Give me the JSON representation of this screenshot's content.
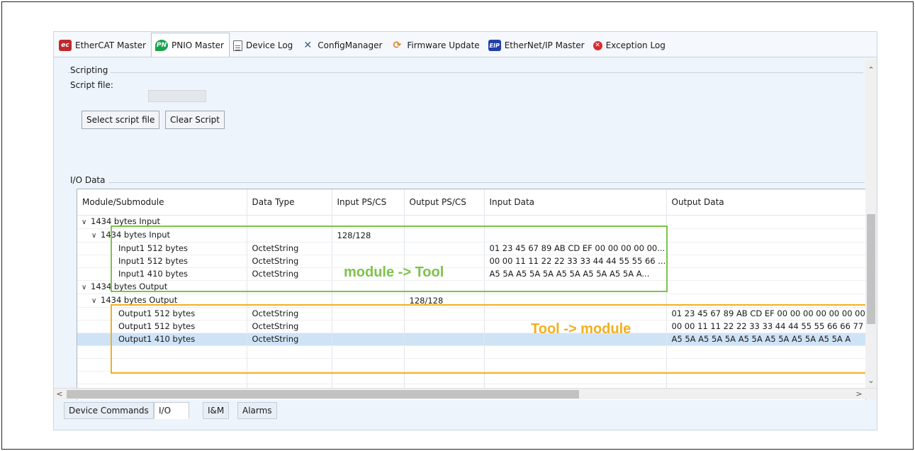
{
  "top_tabs": [
    {
      "label": "EtherCAT Master",
      "icon": "ethercat-icon",
      "badge": "ec"
    },
    {
      "label": "PNIO Master",
      "icon": "profinet-icon",
      "badge": "PN"
    },
    {
      "label": "Device Log",
      "icon": "clipboard-icon",
      "badge": ""
    },
    {
      "label": "ConfigManager",
      "icon": "tools-icon",
      "badge": "✕"
    },
    {
      "label": "Firmware Update",
      "icon": "firmware-update-icon",
      "badge": "⟳"
    },
    {
      "label": "EtherNet/IP Master",
      "icon": "ethernetip-icon",
      "badge": "EIP"
    },
    {
      "label": "Exception Log",
      "icon": "error-icon",
      "badge": "✕"
    }
  ],
  "active_top_tab": "PNIO Master",
  "scripting": {
    "title": "Scripting",
    "script_file_label": "Script file:",
    "script_file_value": "",
    "select_button": "Select script file",
    "clear_button": "Clear Script"
  },
  "io_data": {
    "title": "I/O Data",
    "columns": [
      "Module/Submodule",
      "Data Type",
      "Input PS/CS",
      "Output PS/CS",
      "Input Data",
      "Output Data"
    ],
    "rows": [
      {
        "level": 0,
        "expand": "∨",
        "name": "1434 bytes Input",
        "type": "",
        "in_pscs": "",
        "out_pscs": "",
        "in_data": "",
        "out_data": ""
      },
      {
        "level": 1,
        "expand": "∨",
        "name": "1434 bytes Input",
        "type": "",
        "in_pscs": "128/128",
        "out_pscs": "",
        "in_data": "",
        "out_data": ""
      },
      {
        "level": 2,
        "expand": "",
        "name": "Input1 512 bytes",
        "type": "OctetString",
        "in_pscs": "",
        "out_pscs": "",
        "in_data": "01 23 45 67 89 AB CD EF 00 00 00 00 00...",
        "out_data": ""
      },
      {
        "level": 2,
        "expand": "",
        "name": "Input1 512 bytes",
        "type": "OctetString",
        "in_pscs": "",
        "out_pscs": "",
        "in_data": "00 00 11 11 22 22 33 33 44 44 55 55 66 ...",
        "out_data": ""
      },
      {
        "level": 2,
        "expand": "",
        "name": "Input1 410 bytes",
        "type": "OctetString",
        "in_pscs": "",
        "out_pscs": "",
        "in_data": "A5 5A A5 5A 5A A5 5A A5 5A A5 5A A...",
        "out_data": ""
      },
      {
        "level": 0,
        "expand": "∨",
        "name": "1434 bytes Output",
        "type": "",
        "in_pscs": "",
        "out_pscs": "",
        "in_data": "",
        "out_data": ""
      },
      {
        "level": 1,
        "expand": "∨",
        "name": "1434 bytes Output",
        "type": "",
        "in_pscs": "",
        "out_pscs": "128/128",
        "in_data": "",
        "out_data": ""
      },
      {
        "level": 2,
        "expand": "",
        "name": "Output1 512 bytes",
        "type": "OctetString",
        "in_pscs": "",
        "out_pscs": "",
        "in_data": "",
        "out_data": "01 23 45 67 89 AB CD EF 00 00 00 00 00 00 00"
      },
      {
        "level": 2,
        "expand": "",
        "name": "Output1 512 bytes",
        "type": "OctetString",
        "in_pscs": "",
        "out_pscs": "",
        "in_data": "",
        "out_data": "00 00 11 11 22 22 33 33 44 44 55 55 66 66 77 7"
      },
      {
        "level": 2,
        "expand": "",
        "name": "Output1 410 bytes",
        "type": "OctetString",
        "in_pscs": "",
        "out_pscs": "",
        "in_data": "",
        "out_data": "A5 5A A5 5A 5A A5 5A A5 5A A5 5A A5 5A A"
      },
      {
        "level": -1,
        "expand": "",
        "name": "",
        "type": "",
        "in_pscs": "",
        "out_pscs": "",
        "in_data": "",
        "out_data": ""
      },
      {
        "level": -1,
        "expand": "",
        "name": "",
        "type": "",
        "in_pscs": "",
        "out_pscs": "",
        "in_data": "",
        "out_data": ""
      },
      {
        "level": -1,
        "expand": "",
        "name": "",
        "type": "",
        "in_pscs": "",
        "out_pscs": "",
        "in_data": "",
        "out_data": ""
      },
      {
        "level": -1,
        "expand": "",
        "name": "",
        "type": "",
        "in_pscs": "",
        "out_pscs": "",
        "in_data": "",
        "out_data": ""
      }
    ],
    "selected_row": 9
  },
  "annotations": {
    "input_label": "module -> Tool",
    "input_color": "#7ec24a",
    "output_label": "Tool -> module",
    "output_color": "#f2b01e"
  },
  "bottom_tabs": [
    "Device Commands",
    "I/O",
    "I&M",
    "Alarms"
  ],
  "active_bottom_tab": "I/O",
  "colors": {
    "selection": "#cfe3f7",
    "panel_background": "#eef4fb"
  }
}
